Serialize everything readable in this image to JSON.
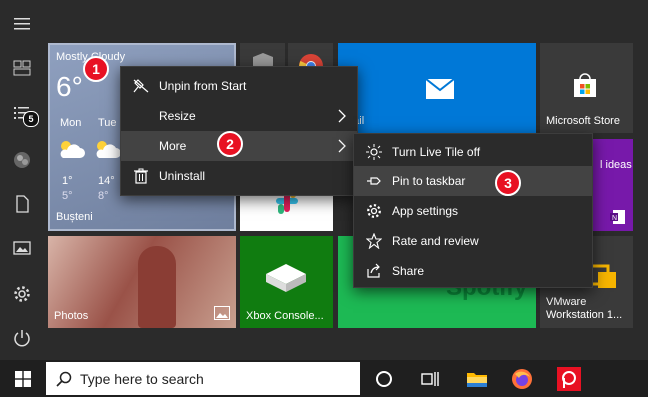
{
  "weather": {
    "header": "Mostly Cloudy",
    "temp": "6°",
    "days": [
      {
        "name": "Mon",
        "hi": "1°",
        "lo": "5°"
      },
      {
        "name": "Tue",
        "hi": "14°",
        "lo": "8°"
      }
    ],
    "location": "Bușteni"
  },
  "tiles": {
    "mail": "Mail",
    "store": "Microsoft Store",
    "ideas": "l ideas",
    "photos": "Photos",
    "xbox": "Xbox Console...",
    "spotify": "Spotify",
    "vmware": "VMware Workstation 1..."
  },
  "menu1": {
    "items": [
      "Unpin from Start",
      "Resize",
      "More",
      "Uninstall"
    ]
  },
  "menu2": {
    "items": [
      "Turn Live Tile off",
      "Pin to taskbar",
      "App settings",
      "Rate and review",
      "Share"
    ]
  },
  "badges": [
    "1",
    "2",
    "3"
  ],
  "rail": {
    "notification_count": "5"
  },
  "taskbar": {
    "search_placeholder": "Type here to search"
  },
  "colors": {
    "accent_blue": "#0078d7",
    "menu_bg": "#2b2b2b",
    "badge_red": "#e81123",
    "store_tile": "#3a3a3a",
    "xbox_green": "#107c10",
    "spotify_green": "#1db954"
  }
}
